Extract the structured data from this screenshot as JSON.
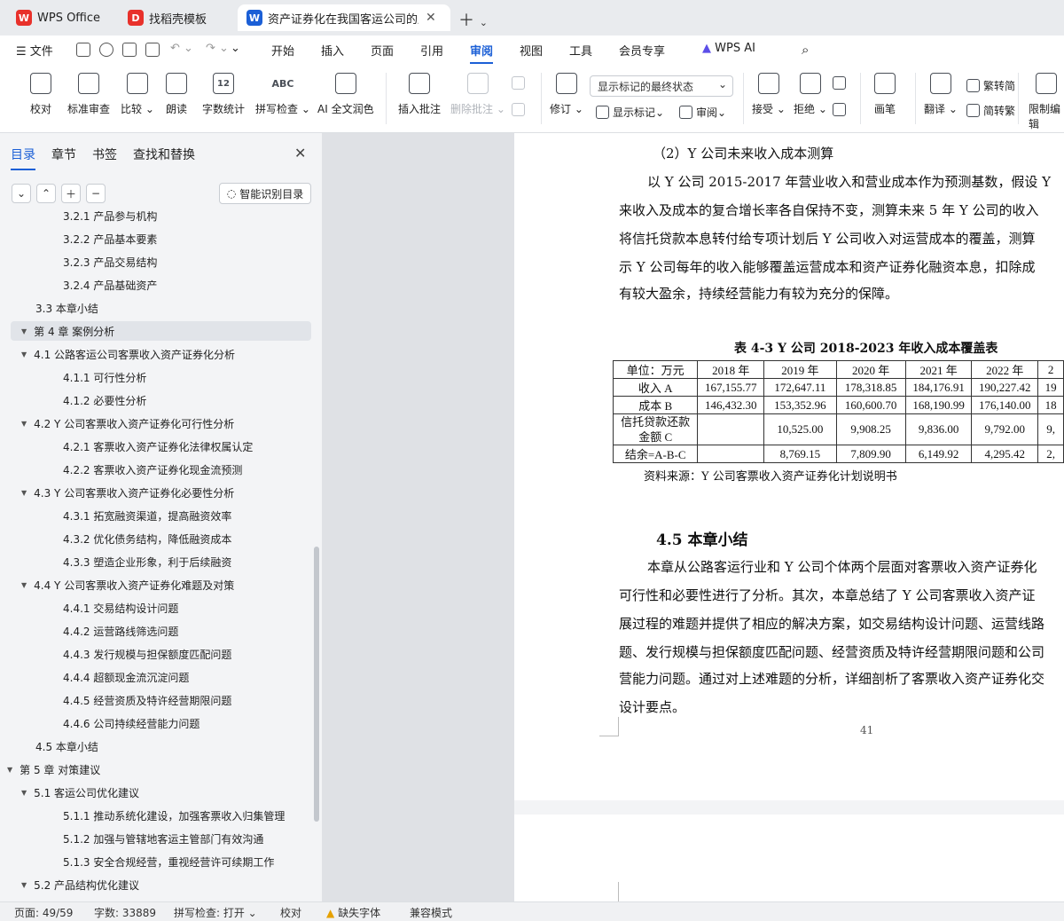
{
  "tabs": [
    {
      "label": "WPS Office"
    },
    {
      "label": "找稻壳模板"
    },
    {
      "label": "资产证券化在我国客运公司的应"
    }
  ],
  "menu": {
    "file": "文件",
    "items": [
      "开始",
      "插入",
      "页面",
      "引用",
      "审阅",
      "视图",
      "工具",
      "会员专享"
    ],
    "ai": "WPS AI"
  },
  "ribbon": {
    "proofread": "校对",
    "standard_review": "标准审查",
    "compare": "比较",
    "read_aloud": "朗读",
    "word_count": "字数统计",
    "spell_check": "拼写检查",
    "ai_polish": "AI 全文润色",
    "insert_comment": "插入批注",
    "delete_comment": "删除批注",
    "revise": "修订",
    "markup_select": "显示标记的最终状态",
    "show_markup": "显示标记",
    "review": "审阅",
    "accept": "接受",
    "reject": "拒绝",
    "pen": "画笔",
    "translate": "翻译",
    "to_traditional": "繁转简",
    "to_simplified": "简转繁",
    "restrict_edit": "限制编辑",
    "word_count_icon": "12",
    "spell_check_icon": "ABC"
  },
  "sidebar": {
    "tabs": [
      "目录",
      "章节",
      "书签",
      "查找和替换"
    ],
    "smart_toc": "智能识别目录",
    "toc": [
      {
        "text": "3.2.1 产品参与机构",
        "level": 3
      },
      {
        "text": "3.2.2 产品基本要素",
        "level": 3
      },
      {
        "text": "3.2.3 产品交易结构",
        "level": 3
      },
      {
        "text": "3.2.4 产品基础资产",
        "level": 3
      },
      {
        "text": "3.3  本章小结",
        "level": 2
      },
      {
        "text": "第 4 章  案例分析",
        "level": 1,
        "expanded": true,
        "selected": true
      },
      {
        "text": "4.1 公路客运公司客票收入资产证券化分析",
        "level": 2,
        "expanded": true
      },
      {
        "text": "4.1.1 可行性分析",
        "level": 3
      },
      {
        "text": "4.1.2 必要性分析",
        "level": 3
      },
      {
        "text": "4.2 Y 公司客票收入资产证券化可行性分析",
        "level": 2,
        "expanded": true
      },
      {
        "text": "4.2.1 客票收入资产证券化法律权属认定",
        "level": 3
      },
      {
        "text": "4.2.2 客票收入资产证券化现金流预测",
        "level": 3
      },
      {
        "text": "4.3 Y 公司客票收入资产证券化必要性分析",
        "level": 2,
        "expanded": true
      },
      {
        "text": "4.3.1 拓宽融资渠道，提高融资效率",
        "level": 3
      },
      {
        "text": "4.3.2 优化债务结构，降低融资成本",
        "level": 3
      },
      {
        "text": "4.3.3 塑造企业形象，利于后续融资",
        "level": 3
      },
      {
        "text": "4.4 Y 公司客票收入资产证券化难题及对策",
        "level": 2,
        "expanded": true
      },
      {
        "text": "4.4.1 交易结构设计问题",
        "level": 3
      },
      {
        "text": "4.4.2 运营路线筛选问题",
        "level": 3
      },
      {
        "text": "4.4.3 发行规模与担保额度匹配问题",
        "level": 3
      },
      {
        "text": "4.4.4 超额现金流沉淀问题",
        "level": 3
      },
      {
        "text": "4.4.5 经营资质及特许经营期限问题",
        "level": 3
      },
      {
        "text": "4.4.6 公司持续经营能力问题",
        "level": 3
      },
      {
        "text": "4.5 本章小结",
        "level": 2
      },
      {
        "text": "第 5 章  对策建议",
        "level": 1,
        "expanded": true
      },
      {
        "text": "5.1  客运公司优化建议",
        "level": 2,
        "expanded": true
      },
      {
        "text": "5.1.1 推动系统化建设，加强客票收入归集管理",
        "level": 3
      },
      {
        "text": "5.1.2 加强与管辖地客运主管部门有效沟通",
        "level": 3
      },
      {
        "text": "5.1.3 安全合规经营，重视经营许可续期工作",
        "level": 3
      },
      {
        "text": "5.2  产品结构优化建议",
        "level": 2,
        "expanded": true
      }
    ]
  },
  "document": {
    "lines": [
      "（2）Y 公司未来收入成本测算",
      "以 Y 公司 2015-2017 年营业收入和营业成本作为预测基数，假设 Y",
      "来收入及成本的复合增长率各自保持不变，测算未来 5 年 Y 公司的收入",
      "将信托贷款本息转付给专项计划后 Y 公司收入对运营成本的覆盖，测算",
      "示 Y 公司每年的收入能够覆盖运营成本和资产证券化融资本息，扣除成",
      "有较大盈余，持续经营能力有较为充分的保障。"
    ],
    "table_caption": "表 4-3 Y 公司 2018-2023 年收入成本覆盖表",
    "table": {
      "header": [
        "单位：万元",
        "2018 年",
        "2019 年",
        "2020 年",
        "2021 年",
        "2022 年",
        "2"
      ],
      "rows": [
        [
          "收入 A",
          "167,155.77",
          "172,647.11",
          "178,318.85",
          "184,176.91",
          "190,227.42",
          "19"
        ],
        [
          "成本 B",
          "146,432.30",
          "153,352.96",
          "160,600.70",
          "168,190.99",
          "176,140.00",
          "18"
        ],
        [
          "信托贷款还款\n金额 C",
          "",
          "10,525.00",
          "9,908.25",
          "9,836.00",
          "9,792.00",
          "9,"
        ],
        [
          "结余=A-B-C",
          "",
          "8,769.15",
          "7,809.90",
          "6,149.92",
          "4,295.42",
          "2,"
        ]
      ]
    },
    "source": "资料来源：Y 公司客票收入资产证券化计划说明书",
    "heading": "4.5 本章小结",
    "para": [
      "本章从公路客运行业和 Y 公司个体两个层面对客票收入资产证券化",
      "可行性和必要性进行了分析。其次，本章总结了 Y 公司客票收入资产证",
      "展过程的难题并提供了相应的解决方案，如交易结构设计问题、运营线路",
      "题、发行规模与担保额度匹配问题、经营资质及特许经营期限问题和公司",
      "营能力问题。通过对上述难题的分析，详细剖析了客票收入资产证券化交",
      "设计要点。"
    ],
    "page_number": "41"
  },
  "status": {
    "page": "页面: 49/59",
    "words": "字数: 33889",
    "spell": "拼写检查: 打开",
    "proof": "校对",
    "missing_font": "缺失字体",
    "compat": "兼容模式"
  }
}
